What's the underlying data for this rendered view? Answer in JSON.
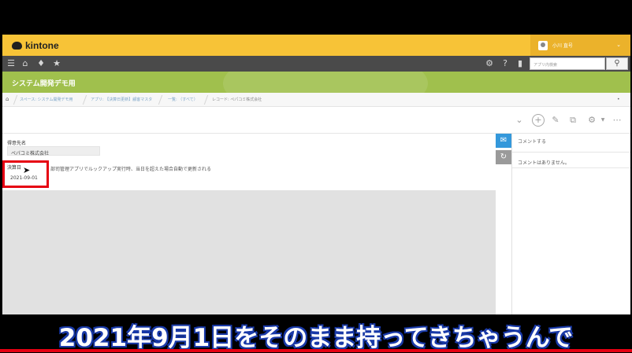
{
  "app": {
    "brand": "kintone",
    "user_name": "小川 直号",
    "search_placeholder": "アプリ内検索",
    "space_title": "システム開発デモ用"
  },
  "breadcrumb": [
    {
      "label": "スペース: システム開発デモ用"
    },
    {
      "label": "アプリ: 【決算日更新】顧客マスタ"
    },
    {
      "label": "一覧: （すべて）"
    },
    {
      "label": "レコード: ペパコミ株式会社"
    }
  ],
  "record": {
    "customer_label": "得意先名",
    "customer_value": "ペパコミ株式会社",
    "closing_label": "決算日",
    "closing_value": "2021-09-01",
    "closing_note": "部司管理アプリでルックアップ実行時、当日を超えた場合自動で更新される"
  },
  "comments": {
    "input_placeholder": "コメントする",
    "empty_text": "コメントはありません。"
  },
  "caption": "2021年9月1日をそのまま持ってきちゃうんで",
  "colors": {
    "header": "#f7c337",
    "banner": "#a0c04d",
    "navbar": "#4a4a4a",
    "highlight": "#e60012",
    "comment_tab": "#3498db"
  },
  "icons": [
    "menu-icon",
    "home-icon",
    "bell-icon",
    "star-icon",
    "gear-icon",
    "help-icon",
    "mobile-icon",
    "search-icon",
    "plus-icon",
    "edit-icon",
    "copy-icon",
    "more-icon",
    "comment-icon",
    "history-icon"
  ]
}
